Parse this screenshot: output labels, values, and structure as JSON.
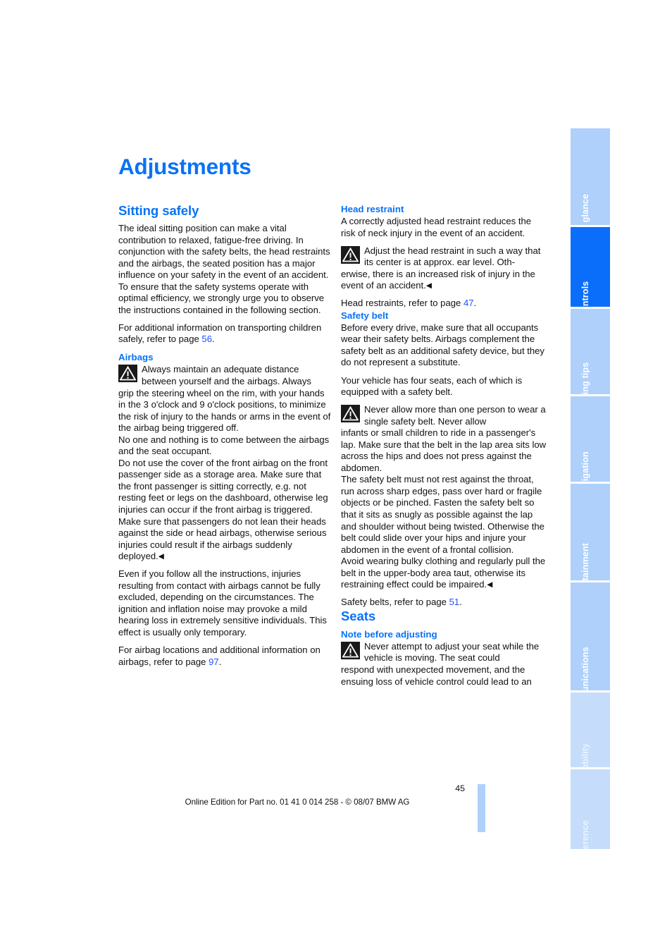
{
  "document": {
    "chapter_title": "Adjustments",
    "page_number": "45",
    "footer_note": "Online Edition for Part no. 01 41 0 014 258 - © 08/07 BMW AG"
  },
  "left_column": {
    "section_title": "Sitting safely",
    "intro_paragraph": "The ideal sitting position can make a vital contribution to relaxed, fatigue-free driving. In conjunction with the safety belts, the head restraints and the airbags, the seated position has a major influence on your safety in the event of an accident. To ensure that the safety systems operate with optimal efficiency, we strongly urge you to observe the instructions contained in the following section.",
    "children_ref_before": "For additional information on transporting children safely, refer to page ",
    "children_ref_page": "56",
    "children_ref_after": ".",
    "airbags": {
      "heading": "Airbags",
      "warning_lead": "Always maintain an adequate distance between yourself and the airbags. Always",
      "warning_body": "grip the steering wheel on the rim, with your hands in the 3 o'clock and 9 o'clock positions, to minimize the risk of injury to the hands or arms in the event of the airbag being triggered off.",
      "warning_body2": "No one and nothing is to come between the airbags and the seat occupant.",
      "warning_body3": "Do not use the cover of the front airbag on the front passenger side as a storage area. Make sure that the front passenger is sitting correctly, e.g. not resting feet or legs on the dashboard, otherwise leg injuries can occur if the front airbag is triggered.",
      "warning_body4": "Make sure that passengers do not lean their heads against the side or head airbags, otherwise serious injuries could result if the airbags suddenly deployed.",
      "end_mark": "◀",
      "note_paragraph": "Even if you follow all the instructions, injuries resulting from contact with airbags cannot be fully excluded, depending on the circumstances. The ignition and inflation noise may provoke a mild hearing loss in extremely sensitive individuals. This effect is usually only temporary.",
      "locations_ref_before": "For airbag locations and additional information on airbags, refer to page ",
      "locations_ref_page": "97",
      "locations_ref_after": "."
    }
  },
  "right_column": {
    "head_restraint": {
      "heading": "Head restraint",
      "intro": "A correctly adjusted head restraint reduces the risk of neck injury in the event of an accident.",
      "warning_lead": "Adjust the head restraint in such a way that its center is at approx. ear level. Oth-",
      "warning_body": "erwise, there is an increased risk of injury in the event of an accident.",
      "end_mark": "◀",
      "ref_before": "Head restraints, refer to page ",
      "ref_page": "47",
      "ref_after": "."
    },
    "safety_belt": {
      "heading": "Safety belt",
      "paragraph1": "Before every drive, make sure that all occupants wear their safety belts. Airbags complement the safety belt as an additional safety device, but they do not represent a substitute.",
      "paragraph2": "Your vehicle has four seats, each of which is equipped with a safety belt.",
      "warning_lead": "Never allow more than one person to wear a single safety belt. Never allow",
      "warning_body": "infants or small children to ride in a passenger's lap. Make sure that the belt in the lap area sits low across the hips and does not press against the abdomen.",
      "warning_body2": "The safety belt must not rest against the throat, run across sharp edges, pass over hard or fragile objects or be pinched. Fasten the safety belt so that it sits as snugly as possible against the lap and shoulder without being twisted. Otherwise the belt could slide over your hips and injure your abdomen in the event of a frontal collision.",
      "warning_body3": "Avoid wearing bulky clothing and regularly pull the belt in the upper-body area taut, otherwise its restraining effect could be impaired.",
      "end_mark": "◀",
      "ref_before": "Safety belts, refer to page ",
      "ref_page": "51",
      "ref_after": "."
    },
    "seats": {
      "section_title": "Seats",
      "heading": "Note before adjusting",
      "warning_lead": "Never attempt to adjust your seat while the vehicle is moving. The seat could",
      "warning_body": "respond with unexpected movement, and the ensuing loss of vehicle control could lead to an"
    }
  },
  "tab_strip": {
    "tabs": [
      {
        "label": "At a glance",
        "state": "inactive"
      },
      {
        "label": "Controls",
        "state": "active"
      },
      {
        "label": "Driving tips",
        "state": "inactive"
      },
      {
        "label": "Navigation",
        "state": "inactive"
      },
      {
        "label": "Entertainment",
        "state": "inactive"
      },
      {
        "label": "Communications",
        "state": "inactive"
      },
      {
        "label": "Mobility",
        "state": "faded"
      },
      {
        "label": "Reference",
        "state": "faded"
      }
    ]
  },
  "colors": {
    "heading_blue": "#0a72f5",
    "tab_active": "#0a6efa",
    "tab_inactive": "#aed0fb",
    "tab_faded": "#c5ddfb",
    "page_ref_link": "#2050ff"
  }
}
